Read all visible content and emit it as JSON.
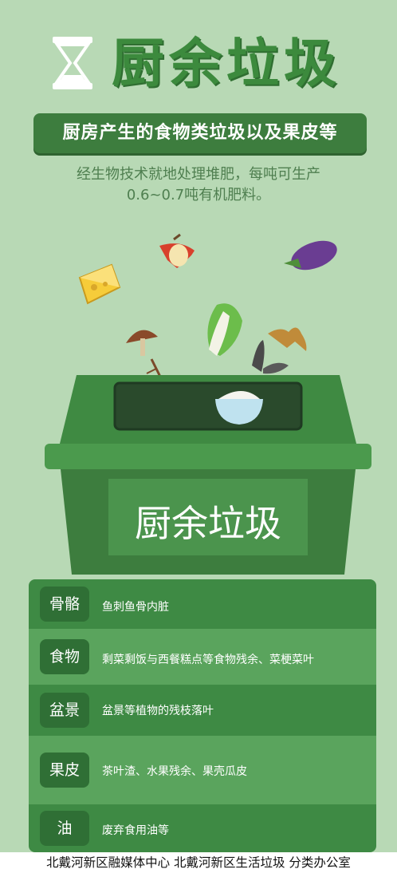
{
  "header": {
    "title": "厨余垃圾",
    "banner": "厨房产生的食物类垃圾以及果皮等",
    "desc_line1": "经生物技术就地处理堆肥，每吨可生产",
    "desc_line2": "0.6~0.7吨有机肥料。"
  },
  "bin": {
    "label": "厨余垃圾"
  },
  "categories": [
    {
      "label": "骨骼",
      "desc": "鱼刺鱼骨内脏"
    },
    {
      "label": "食物",
      "desc": "剩菜剩饭与西餐糕点等食物残余、菜梗菜叶"
    },
    {
      "label": "盆景",
      "desc": "盆景等植物的残枝落叶"
    },
    {
      "label": "果皮",
      "desc": "茶叶渣、水果残余、果壳瓜皮"
    },
    {
      "label": "油",
      "desc": "废弃食用油等"
    }
  ],
  "footer": {
    "text": "北戴河新区融媒体中心  北戴河新区生活垃圾 分类办公室"
  },
  "icons": [
    "hourglass-icon",
    "cheese-icon",
    "apple-core-icon",
    "eggplant-icon",
    "mushroom-icon",
    "cabbage-icon",
    "banana-peel-icon",
    "seed-shell-icon",
    "rice-bowl-icon",
    "fishbone-icon"
  ],
  "colors": {
    "background": "#b8d9b5",
    "primary_green": "#3d7d3e",
    "bin_green": "#3f8a42",
    "title_green": "#3c8a3d"
  }
}
